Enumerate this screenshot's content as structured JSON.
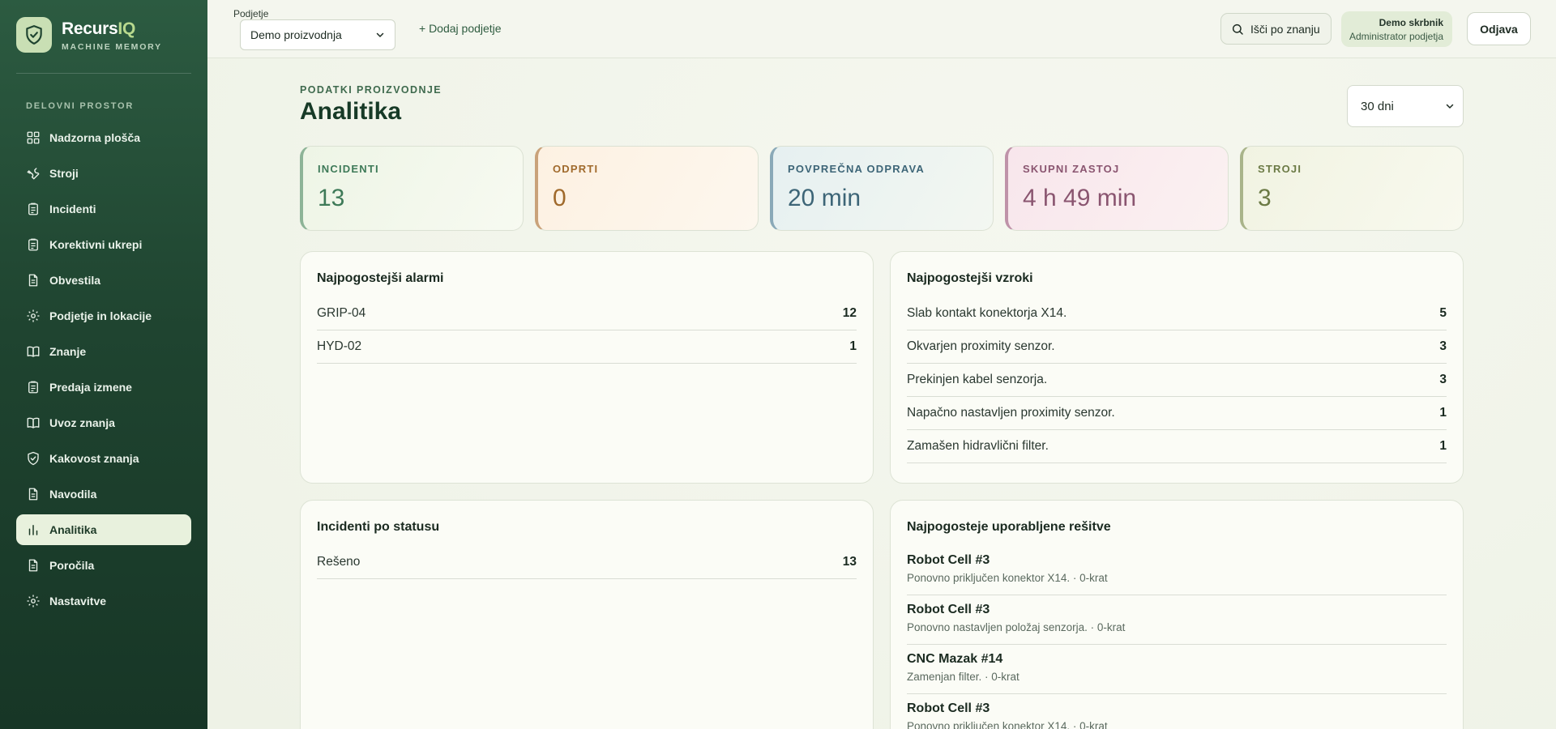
{
  "brand": {
    "name_main": "Recurs",
    "name_accent": "IQ",
    "subtitle": "MACHINE MEMORY"
  },
  "sidebar": {
    "section_label": "DELOVNI PROSTOR",
    "items": [
      {
        "label": "Nadzorna plošča",
        "icon": "dashboard-icon"
      },
      {
        "label": "Stroji",
        "icon": "wrench-icon"
      },
      {
        "label": "Incidenti",
        "icon": "clipboard-icon"
      },
      {
        "label": "Korektivni ukrepi",
        "icon": "clipboard-icon"
      },
      {
        "label": "Obvestila",
        "icon": "document-icon"
      },
      {
        "label": "Podjetje in lokacije",
        "icon": "gear-icon"
      },
      {
        "label": "Znanje",
        "icon": "book-icon"
      },
      {
        "label": "Predaja izmene",
        "icon": "clipboard-icon"
      },
      {
        "label": "Uvoz znanja",
        "icon": "book-icon"
      },
      {
        "label": "Kakovost znanja",
        "icon": "shield-icon"
      },
      {
        "label": "Navodila",
        "icon": "document-icon"
      },
      {
        "label": "Analitika",
        "icon": "bar-chart-icon",
        "active": true
      },
      {
        "label": "Poročila",
        "icon": "document-icon"
      },
      {
        "label": "Nastavitve",
        "icon": "gear-icon"
      }
    ]
  },
  "topbar": {
    "company_label": "Podjetje",
    "company_selected": "Demo proizvodnja",
    "add_company": "+ Dodaj podjetje",
    "search_label": "Išči po znanju",
    "user_name": "Demo skrbnik",
    "user_role": "Administrator podjetja",
    "logout": "Odjava"
  },
  "page": {
    "eyebrow": "PODATKI PROIZVODNJE",
    "title": "Analitika",
    "range_selected": "30 dni"
  },
  "stats": [
    {
      "label": "INCIDENTI",
      "value": "13",
      "color": "#3e7a58"
    },
    {
      "label": "ODPRTI",
      "value": "0",
      "color": "#a06a2c"
    },
    {
      "label": "POVPREČNA ODPRAVA",
      "value": "20 min",
      "color": "#3d6577"
    },
    {
      "label": "SKUPNI ZASTOJ",
      "value": "4 h 49 min",
      "color": "#8a5570"
    },
    {
      "label": "STROJI",
      "value": "3",
      "color": "#6b7a45"
    }
  ],
  "alarms": {
    "title": "Najpogostejši alarmi",
    "rows": [
      {
        "name": "GRIP-04",
        "count": "12"
      },
      {
        "name": "HYD-02",
        "count": "1"
      }
    ]
  },
  "causes": {
    "title": "Najpogostejši vzroki",
    "rows": [
      {
        "name": "Slab kontakt konektorja X14.",
        "count": "5"
      },
      {
        "name": "Okvarjen proximity senzor.",
        "count": "3"
      },
      {
        "name": "Prekinjen kabel senzorja.",
        "count": "3"
      },
      {
        "name": "Napačno nastavljen proximity senzor.",
        "count": "1"
      },
      {
        "name": "Zamašen hidravlični filter.",
        "count": "1"
      }
    ]
  },
  "status": {
    "title": "Incidenti po statusu",
    "rows": [
      {
        "name": "Rešeno",
        "count": "13"
      }
    ]
  },
  "solutions": {
    "title": "Najpogosteje uporabljene rešitve",
    "items": [
      {
        "machine": "Robot Cell #3",
        "detail": "Ponovno priključen konektor X14. · 0-krat"
      },
      {
        "machine": "Robot Cell #3",
        "detail": "Ponovno nastavljen položaj senzorja. · 0-krat"
      },
      {
        "machine": "CNC Mazak #14",
        "detail": "Zamenjan filter. · 0-krat"
      },
      {
        "machine": "Robot Cell #3",
        "detail": "Ponovno priključen konektor X14. · 0-krat"
      }
    ]
  }
}
